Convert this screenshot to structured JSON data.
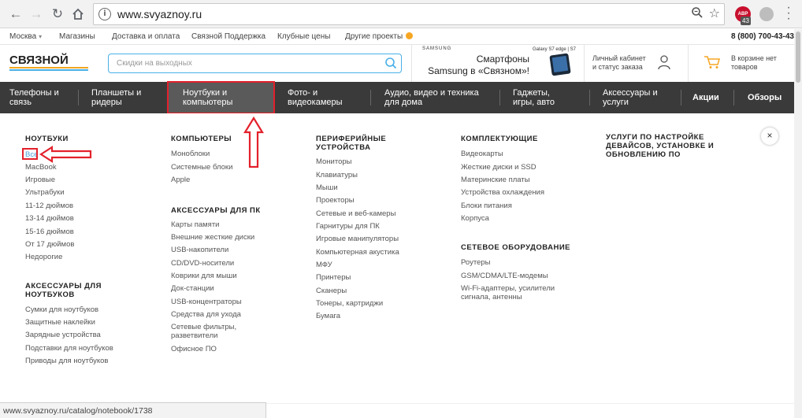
{
  "browser": {
    "url": "www.svyaznoy.ru",
    "extension_badge": "43",
    "extension_label": "ABP"
  },
  "topbar": {
    "city": "Москва",
    "links": [
      "Магазины",
      "Доставка и оплата",
      "Связной Поддержка",
      "Клубные цены",
      "Другие проекты"
    ],
    "phone": "8 (800) 700-43-43"
  },
  "header": {
    "logo_text": "СВЯЗНОЙ",
    "search_placeholder": "Скидки на выходных",
    "promo": {
      "brand": "SAMSUNG",
      "model": "Galaxy S7 edge | S7",
      "line1": "Смартфоны",
      "line2": "Samsung в «Связном»!"
    },
    "account": [
      "Личный кабинет",
      "и статус заказа"
    ],
    "cart": [
      "В корзине нет",
      "товаров"
    ]
  },
  "categories": [
    [
      "Телефоны и",
      "связь"
    ],
    [
      "Планшеты и",
      "ридеры"
    ],
    [
      "Ноутбуки и",
      "компьютеры"
    ],
    [
      "Фото- и",
      "видеокамеры"
    ],
    [
      "Аудио, видео и техника",
      "для дома"
    ],
    [
      "Гаджеты,",
      "игры, авто"
    ],
    [
      "Аксессуары и",
      "услуги"
    ],
    [
      "Акции"
    ],
    [
      "Обзоры"
    ]
  ],
  "menu": {
    "notebooks": {
      "title": "НОУТБУКИ",
      "items": [
        "Все",
        "MacBook",
        "Игровые",
        "Ультрабуки",
        "11-12 дюймов",
        "13-14 дюймов",
        "15-16 дюймов",
        "От 17 дюймов",
        "Недорогие"
      ]
    },
    "notebook_accessories": {
      "title": [
        "АКСЕССУАРЫ ДЛЯ",
        "НОУТБУКОВ"
      ],
      "items": [
        "Сумки для ноутбуков",
        "Защитные наклейки",
        "Зарядные устройства",
        "Подставки для ноутбуков",
        "Приводы для ноутбуков"
      ]
    },
    "computers": {
      "title": "КОМПЬЮТЕРЫ",
      "items": [
        "Моноблоки",
        "Системные блоки",
        "Apple"
      ]
    },
    "pc_accessories": {
      "title": "АКСЕССУАРЫ ДЛЯ ПК",
      "items": [
        "Карты памяти",
        "Внешние жесткие диски",
        "USB-накопители",
        "CD/DVD-носители",
        "Коврики для мыши",
        "Док-станции",
        "USB-концентраторы",
        "Средства для ухода",
        [
          "Сетевые фильтры,",
          "разветвители"
        ],
        "Офисное ПО"
      ]
    },
    "peripherals": {
      "title": [
        "ПЕРИФЕРИЙНЫЕ",
        "УСТРОЙСТВА"
      ],
      "items": [
        "Мониторы",
        "Клавиатуры",
        "Мыши",
        "Проекторы",
        "Сетевые и веб-камеры",
        "Гарнитуры для ПК",
        "Игровые манипуляторы",
        "Компьютерная акустика",
        "МФУ",
        "Принтеры",
        "Сканеры",
        "Тонеры, картриджи",
        "Бумага"
      ]
    },
    "components": {
      "title": "КОМПЛЕКТУЮЩИЕ",
      "items": [
        "Видеокарты",
        "Жесткие диски и SSD",
        "Материнские платы",
        "Устройства охлаждения",
        "Блоки питания",
        "Корпуса"
      ]
    },
    "network": {
      "title": "СЕТЕВОЕ ОБОРУДОВАНИЕ",
      "items": [
        "Роутеры",
        "GSM/CDMA/LTE-модемы",
        [
          "Wi-Fi-адаптеры, усилители",
          "сигнала, антенны"
        ]
      ]
    },
    "services": {
      "title": [
        "УСЛУГИ ПО НАСТРОЙКЕ",
        "ДЕВАЙСОВ, УСТАНОВКЕ И",
        "ОБНОВЛЕНИЮ ПО"
      ]
    },
    "close_label": "×"
  },
  "status_url": "www.svyaznoy.ru/catalog/notebook/1738",
  "colors": {
    "accent_blue": "#4ab0e8",
    "nav_bg": "#3a3a3a",
    "annotation_red": "#e3212b"
  }
}
